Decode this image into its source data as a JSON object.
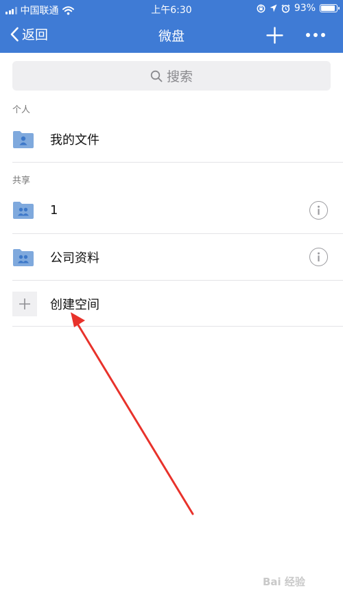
{
  "status_bar": {
    "carrier": "中国联通",
    "time": "上午6:30",
    "battery_percent": "93%",
    "battery_level": 0.93
  },
  "nav": {
    "back_label": "返回",
    "title": "微盘"
  },
  "search": {
    "placeholder": "搜索"
  },
  "sections": {
    "personal_label": "个人",
    "shared_label": "共享"
  },
  "personal_items": [
    {
      "label": "我的文件",
      "icon": "folder-person-icon"
    }
  ],
  "shared_items": [
    {
      "label": "1",
      "icon": "folder-group-icon"
    },
    {
      "label": "公司资料",
      "icon": "folder-group-icon"
    }
  ],
  "create_space": {
    "label": "创建空间"
  },
  "watermark": "Bai 经验",
  "colors": {
    "header": "#3f7bd5",
    "folder": "#7fa9dd",
    "annotation_arrow": "#e8322b"
  }
}
